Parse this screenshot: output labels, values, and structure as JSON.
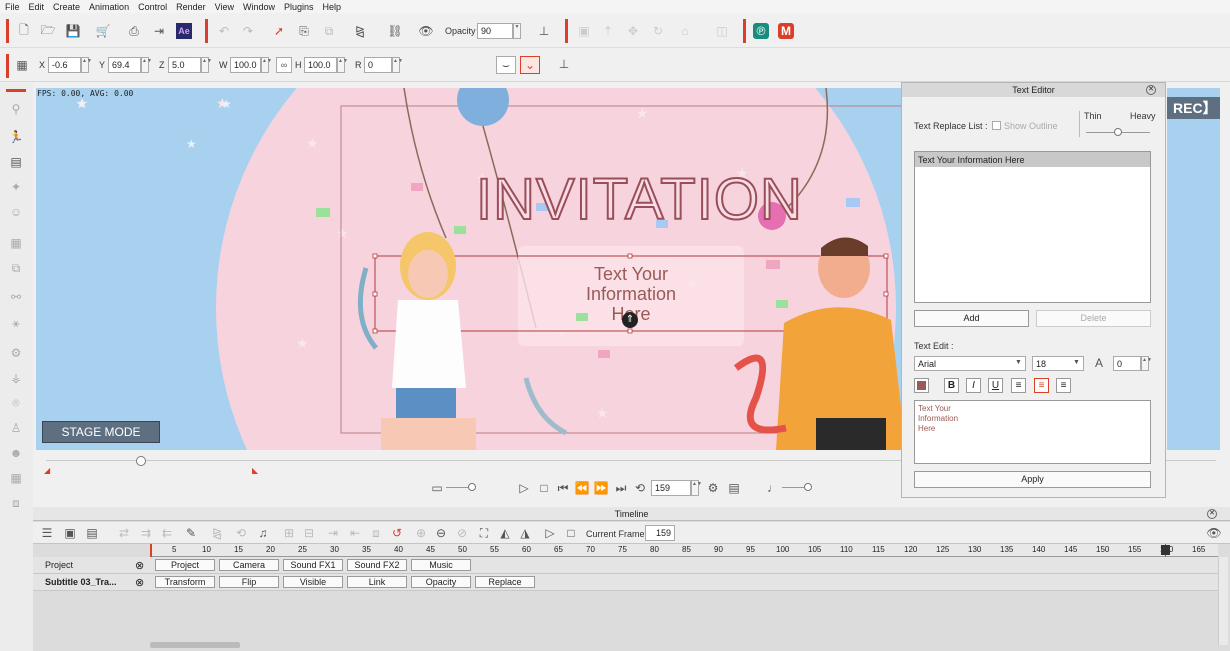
{
  "menu": [
    "File",
    "Edit",
    "Create",
    "Animation",
    "Control",
    "Render",
    "View",
    "Window",
    "Plugins",
    "Help"
  ],
  "toolbar": {
    "opacity_label": "Opacity :",
    "opacity_value": "90",
    "ae_label": "Ae"
  },
  "transform": {
    "x_label": "X",
    "x_value": "-0.6",
    "y_label": "Y",
    "y_value": "69.4",
    "z_label": "Z",
    "z_value": "5.0",
    "w_label": "W",
    "w_value": "100.0",
    "h_label": "H",
    "h_value": "100.0",
    "r_label": "R",
    "r_value": "0"
  },
  "stage": {
    "fps": "FPS: 0.00, AVG: 0.00",
    "title": "INVITATION",
    "subtitle": [
      "Text Your",
      "Information",
      "Here"
    ],
    "mode_button": "STAGE MODE",
    "rec": "REC"
  },
  "playback": {
    "frame": "159"
  },
  "editor": {
    "title": "Text Editor",
    "replace_label": "Text Replace List :",
    "show_outline": "Show Outline",
    "thin": "Thin",
    "heavy": "Heavy",
    "list_item": "Text Your Information Here",
    "add": "Add",
    "delete": "Delete",
    "text_edit_label": "Text Edit :",
    "font": "Arial",
    "size": "18",
    "spacing": "0",
    "bold": "B",
    "italic": "I",
    "underline": "U",
    "text_lines": [
      "Text Your",
      "Information",
      "Here"
    ],
    "apply": "Apply",
    "color": "#9a5a55"
  },
  "timeline": {
    "title": "Timeline",
    "current_frame_label": "Current Frame:",
    "current_frame": "159",
    "ruler": [
      "5",
      "10",
      "15",
      "20",
      "25",
      "30",
      "35",
      "40",
      "45",
      "50",
      "55",
      "60",
      "65",
      "70",
      "75",
      "80",
      "85",
      "90",
      "95",
      "100",
      "105",
      "110",
      "115",
      "120",
      "125",
      "130",
      "135",
      "140",
      "145",
      "150",
      "155",
      "160",
      "165"
    ],
    "tracks": [
      {
        "name": "Project",
        "chips": [
          "Project",
          "Camera",
          "Sound FX1",
          "Sound FX2",
          "Music"
        ]
      },
      {
        "name": "Subtitle 03_Tra...",
        "chips": [
          "Transform",
          "Flip",
          "Visible",
          "Link",
          "Opacity",
          "Replace"
        ]
      }
    ]
  }
}
